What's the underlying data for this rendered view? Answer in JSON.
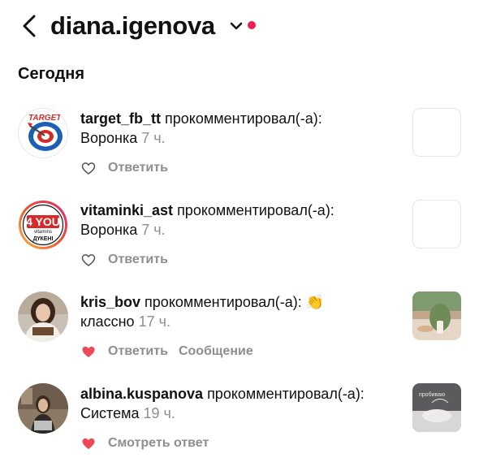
{
  "header": {
    "username": "diana.igenova"
  },
  "section_title": "Сегодня",
  "notifications": [
    {
      "username": "target_fb_tt",
      "action": " прокомментировал(-а):",
      "comment": "Воронка",
      "time": "7 ч.",
      "actions": [
        "Ответить"
      ],
      "liked": false,
      "avatar_text": "TARGET"
    },
    {
      "username": "vitaminki_ast",
      "action": " прокомментировал(-а):",
      "comment": "Воронка",
      "time": "7 ч.",
      "actions": [
        "Ответить"
      ],
      "liked": false,
      "avatar_text": "4 YOU",
      "avatar_subtext": "vitamins",
      "avatar_bottom": "ДҮКЕНІ"
    },
    {
      "username": "kris_bov",
      "action": " прокомментировал(-а):",
      "comment": "классно",
      "time": "17 ч.",
      "actions": [
        "Ответить",
        "Сообщение"
      ],
      "liked": true,
      "emoji": "👏"
    },
    {
      "username": "albina.kuspanova",
      "action": " прокомментировал(-а):",
      "comment": "Система",
      "time": "19 ч.",
      "actions": [
        "Смотреть ответ"
      ],
      "liked": true,
      "thumb_text": "пробиваю"
    }
  ],
  "colors": {
    "like": "#ed4956",
    "muted": "#8e8e8e",
    "dot": "#ee1d52",
    "ring_start": "#fdb33b",
    "ring_end": "#d62976"
  },
  "icons": {
    "back": "chevron-left-icon",
    "account_switch": "chevron-down-icon",
    "like": "heart-icon"
  }
}
